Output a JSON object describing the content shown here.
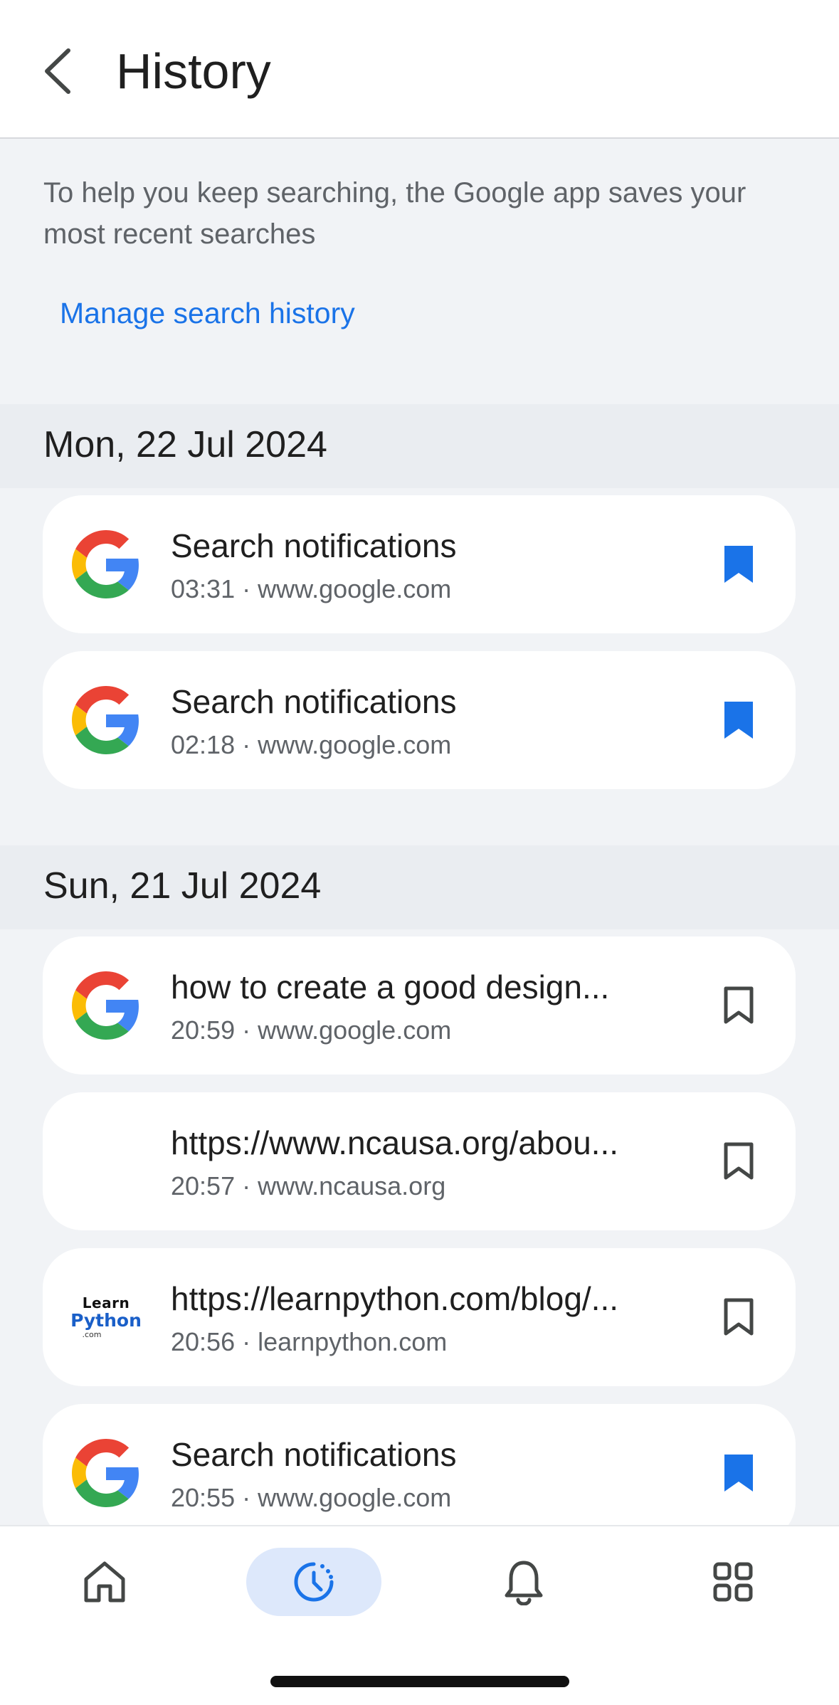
{
  "header": {
    "title": "History"
  },
  "intro": {
    "text": "To help you keep searching, the Google app saves your most recent searches",
    "manage_link": "Manage search history"
  },
  "sections": [
    {
      "date": "Mon, 22 Jul 2024",
      "items": [
        {
          "title": "Search notifications",
          "meta": "03:31 · www.google.com",
          "favicon": "google-g-icon",
          "saved": true
        },
        {
          "title": "Search notifications",
          "meta": "02:18 · www.google.com",
          "favicon": "google-g-icon",
          "saved": true
        }
      ]
    },
    {
      "date": "Sun, 21 Jul 2024",
      "items": [
        {
          "title": "how to create a good design...",
          "meta": "20:59 · www.google.com",
          "favicon": "google-g-icon",
          "saved": false
        },
        {
          "title": "https://www.ncausa.org/abou...",
          "meta": "20:57 · www.ncausa.org",
          "favicon": "none",
          "saved": false
        },
        {
          "title": "https://learnpython.com/blog/...",
          "meta": "20:56 · learnpython.com",
          "favicon": "learnpython-logo",
          "saved": false
        },
        {
          "title": "Search notifications",
          "meta": "20:55 · www.google.com",
          "favicon": "google-g-icon",
          "saved": true
        }
      ]
    }
  ],
  "learnpython_logo": {
    "line1": "Learn",
    "line2": "Python",
    "line3": ".com"
  },
  "nav": {
    "items": [
      "home-icon",
      "history-icon",
      "notifications-bell-icon",
      "apps-grid-icon"
    ],
    "active": "history-icon"
  },
  "colors": {
    "accent": "#1a73e8",
    "background": "#f1f3f6",
    "card": "#ffffff",
    "nav_active_pill": "#dde8fb"
  }
}
